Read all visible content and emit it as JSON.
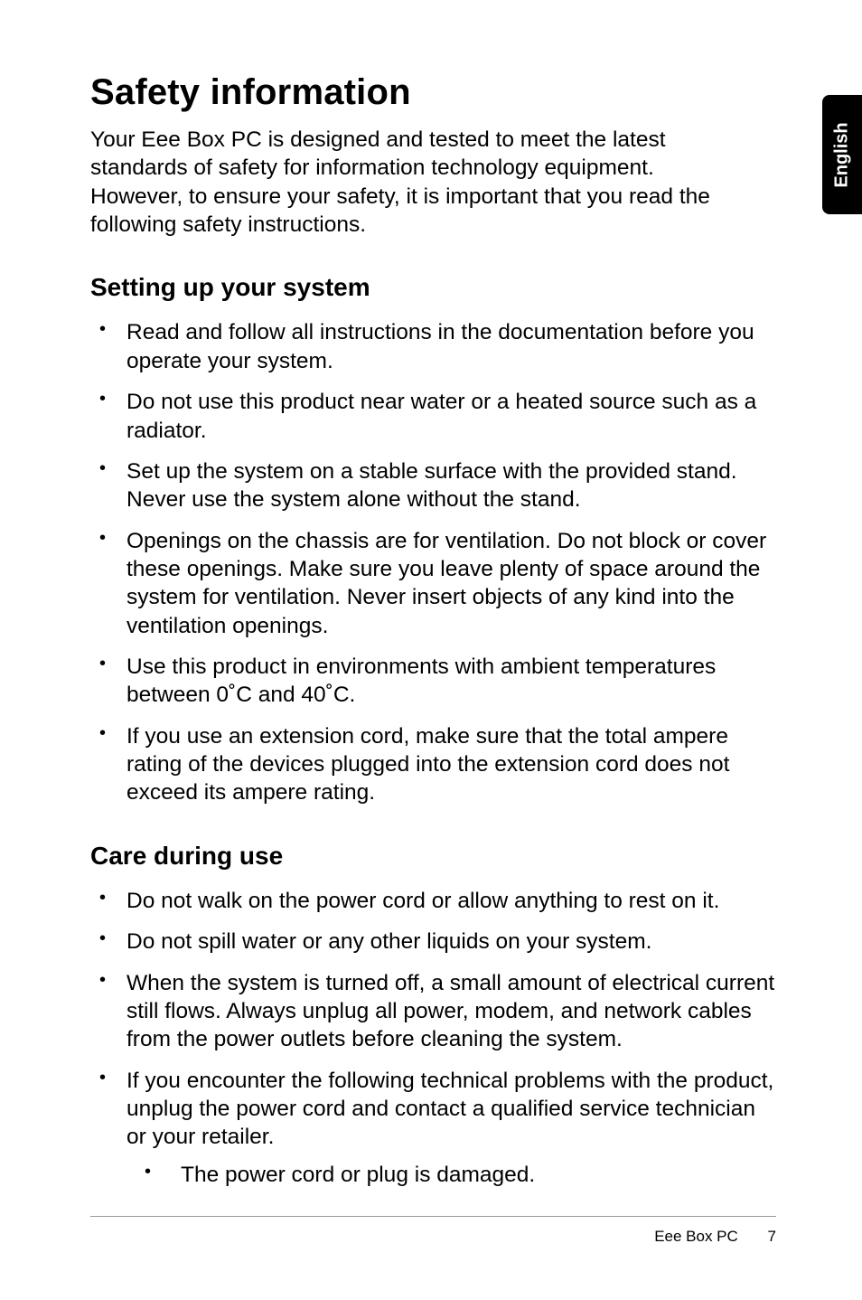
{
  "side_tab": "English",
  "title": "Safety information",
  "intro": "Your Eee Box PC is designed and tested to meet the latest standards of safety for information technology equipment. However, to ensure your safety, it is important that you read the following safety instructions.",
  "sections": [
    {
      "heading": "Setting up your system",
      "items": [
        "Read and follow all instructions in the documentation before you operate your system.",
        "Do not use this product near water or a heated source such as a radiator.",
        "Set up the system on a stable surface with the provided stand. Never use the system alone without the stand.",
        "Openings on the chassis are for ventilation. Do not block or cover these openings. Make sure you leave plenty of space around the system for ventilation. Never insert objects of any kind into the ventilation openings.",
        "Use this product in environments with ambient temperatures between 0˚C and 40˚C.",
        "If you use an extension cord, make sure that the total ampere rating of the devices plugged into the extension cord does not exceed its ampere rating."
      ]
    },
    {
      "heading": "Care during use",
      "items": [
        "Do not walk on the power cord or allow anything to rest on it.",
        "Do not spill water or any other liquids on your system.",
        "When the system is turned off, a small amount of electrical current still flows. Always unplug all power, modem, and network cables from the power outlets before cleaning the system.",
        "If you encounter the following technical problems with the product, unplug the power cord and contact a qualified service technician or your retailer."
      ],
      "subitems_for_last": [
        "The power cord or plug is damaged."
      ]
    }
  ],
  "footer": {
    "label": "Eee Box PC",
    "page": "7"
  }
}
